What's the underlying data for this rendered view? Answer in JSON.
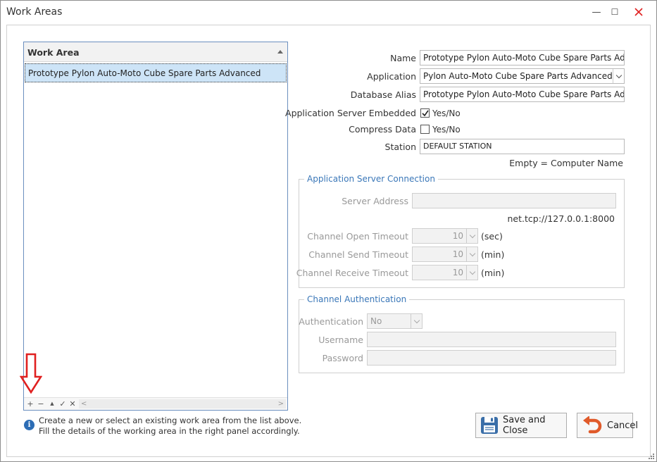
{
  "window": {
    "title": "Work Areas",
    "minimize_glyph": "—",
    "maximize_glyph": "☐"
  },
  "list": {
    "header": "Work Area",
    "rows": [
      "Prototype Pylon Auto-Moto Cube Spare Parts Advanced"
    ],
    "nav": {
      "add": "+",
      "remove": "−",
      "up": "▲",
      "apply": "✓",
      "cancel": "✕",
      "scroll_left": "<",
      "scroll_right": ">"
    }
  },
  "hint": {
    "icon": "info-icon",
    "line1": "Create a new or select an existing work area from the list above.",
    "line2": "Fill the details of the working area in the right panel accordingly."
  },
  "form": {
    "name_label": "Name",
    "name_value": "Prototype Pylon Auto-Moto Cube Spare Parts Advanced",
    "application_label": "Application",
    "application_value": "Pylon Auto-Moto Cube Spare Parts Advanced",
    "alias_label": "Database Alias",
    "alias_value": "Prototype Pylon Auto-Moto Cube Spare Parts Advanced",
    "embedded_label": "Application Server Embedded",
    "embedded_checked": true,
    "embedded_text": "Yes/No",
    "compress_label": "Compress Data",
    "compress_checked": false,
    "compress_text": "Yes/No",
    "station_label": "Station",
    "station_value": "DEFAULT STATION",
    "station_note": "Empty = Computer Name"
  },
  "server_connection": {
    "title": "Application Server Connection",
    "address_label": "Server Address",
    "address_value": "",
    "address_note": "net.tcp://127.0.0.1:8000",
    "open_label": "Channel Open Timeout",
    "open_value": "10",
    "open_unit": "(sec)",
    "send_label": "Channel Send Timeout",
    "send_value": "10",
    "send_unit": "(min)",
    "receive_label": "Channel Receive Timeout",
    "receive_value": "10",
    "receive_unit": "(min)"
  },
  "authentication": {
    "title": "Channel Authentication",
    "auth_label": "Authentication",
    "auth_value": "No",
    "username_label": "Username",
    "username_value": "",
    "password_label": "Password",
    "password_value": ""
  },
  "buttons": {
    "save": "Save and Close",
    "cancel": "Cancel"
  },
  "colors": {
    "accent": "#3a77b8",
    "selection": "#cde4f7",
    "annotation_arrow": "#e02020"
  }
}
